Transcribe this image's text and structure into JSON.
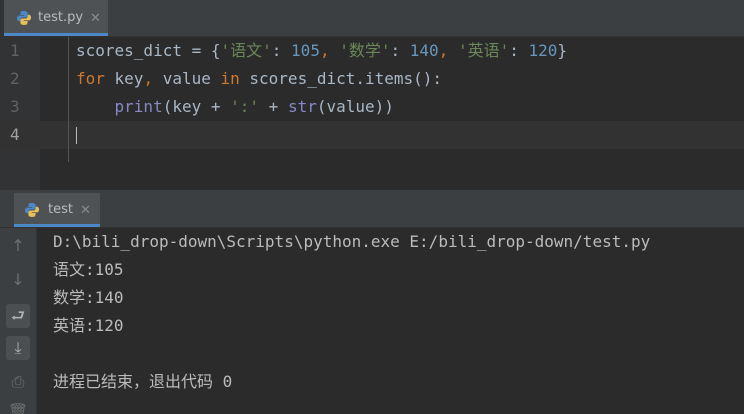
{
  "editor": {
    "tab": {
      "filename": "test.py",
      "close": "✕"
    },
    "line_numbers": [
      "1",
      "2",
      "3",
      "4"
    ],
    "lines": [
      [
        {
          "t": "scores_dict = {",
          "c": ""
        },
        {
          "t": "'语文'",
          "c": "str"
        },
        {
          "t": ": ",
          "c": ""
        },
        {
          "t": "105",
          "c": "num"
        },
        {
          "t": ", ",
          "c": "kw"
        },
        {
          "t": "'数学'",
          "c": "str"
        },
        {
          "t": ": ",
          "c": ""
        },
        {
          "t": "140",
          "c": "num"
        },
        {
          "t": ", ",
          "c": "kw"
        },
        {
          "t": "'英语'",
          "c": "str"
        },
        {
          "t": ": ",
          "c": ""
        },
        {
          "t": "120",
          "c": "num"
        },
        {
          "t": "}",
          "c": ""
        }
      ],
      [
        {
          "t": "for",
          "c": "kw"
        },
        {
          "t": " key",
          "c": ""
        },
        {
          "t": ", ",
          "c": "kw"
        },
        {
          "t": "value ",
          "c": ""
        },
        {
          "t": "in",
          "c": "kw"
        },
        {
          "t": " scores_dict.items():",
          "c": ""
        }
      ],
      [
        {
          "t": "    ",
          "c": ""
        },
        {
          "t": "print",
          "c": "bi"
        },
        {
          "t": "(key + ",
          "c": ""
        },
        {
          "t": "':'",
          "c": "str"
        },
        {
          "t": " + ",
          "c": ""
        },
        {
          "t": "str",
          "c": "bi"
        },
        {
          "t": "(value))",
          "c": ""
        }
      ],
      []
    ]
  },
  "run": {
    "tab": {
      "label": "test",
      "close": "✕"
    },
    "toolbar": [
      {
        "name": "scroll-up-icon",
        "glyph": "↑",
        "active": false
      },
      {
        "name": "scroll-down-icon",
        "glyph": "↓",
        "active": false
      },
      {
        "name": "soft-wrap-icon",
        "glyph": "⮐",
        "active": true
      },
      {
        "name": "scroll-to-end-icon",
        "glyph": "⤓",
        "active": true
      },
      {
        "name": "print-icon",
        "glyph": "⎙",
        "active": false
      },
      {
        "name": "delete-icon",
        "glyph": "🗑",
        "active": false
      }
    ],
    "console_lines": [
      "D:\\bili_drop-down\\Scripts\\python.exe E:/bili_drop-down/test.py",
      "语文:105",
      "数学:140",
      "英语:120",
      "",
      "进程已结束，退出代码 0"
    ]
  },
  "colors": {
    "background": "#2b2b2b",
    "keyword": "#cc7832",
    "string": "#6a8759",
    "number": "#6897bb",
    "builtin": "#8888c6",
    "accent": "#4a88c7"
  }
}
